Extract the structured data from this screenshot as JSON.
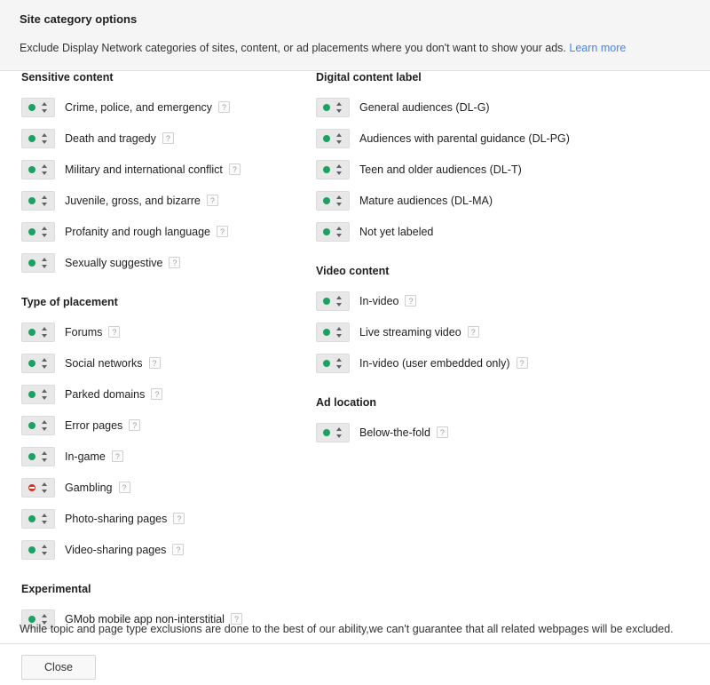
{
  "header": {
    "title": "Site category options",
    "description": "Exclude Display Network categories of sites, content, or ad placements where you don't want to show your ads.",
    "learn_more": "Learn more"
  },
  "status": {
    "included_label": "included",
    "excluded_label": "excluded"
  },
  "help_glyph": "?",
  "columns": {
    "left": [
      {
        "heading": "Sensitive content",
        "items": [
          {
            "label": "Crime, police, and emergency",
            "state": "included",
            "help": true
          },
          {
            "label": "Death and tragedy",
            "state": "included",
            "help": true
          },
          {
            "label": "Military and international conflict",
            "state": "included",
            "help": true
          },
          {
            "label": "Juvenile, gross, and bizarre",
            "state": "included",
            "help": true
          },
          {
            "label": "Profanity and rough language",
            "state": "included",
            "help": true
          },
          {
            "label": "Sexually suggestive",
            "state": "included",
            "help": true
          }
        ]
      },
      {
        "heading": "Type of placement",
        "items": [
          {
            "label": "Forums",
            "state": "included",
            "help": true
          },
          {
            "label": "Social networks",
            "state": "included",
            "help": true
          },
          {
            "label": "Parked domains",
            "state": "included",
            "help": true
          },
          {
            "label": "Error pages",
            "state": "included",
            "help": true
          },
          {
            "label": "In-game",
            "state": "included",
            "help": true
          },
          {
            "label": "Gambling",
            "state": "excluded",
            "help": true
          },
          {
            "label": "Photo-sharing pages",
            "state": "included",
            "help": true
          },
          {
            "label": "Video-sharing pages",
            "state": "included",
            "help": true
          }
        ]
      },
      {
        "heading": "Experimental",
        "items": [
          {
            "label": "GMob mobile app non-interstitial",
            "state": "included",
            "help": true
          }
        ]
      }
    ],
    "right": [
      {
        "heading": "Digital content label",
        "items": [
          {
            "label": "General audiences (DL-G)",
            "state": "included",
            "help": false
          },
          {
            "label": "Audiences with parental guidance (DL-PG)",
            "state": "included",
            "help": false
          },
          {
            "label": "Teen and older audiences (DL-T)",
            "state": "included",
            "help": false
          },
          {
            "label": "Mature audiences (DL-MA)",
            "state": "included",
            "help": false
          },
          {
            "label": "Not yet labeled",
            "state": "included",
            "help": false
          }
        ]
      },
      {
        "heading": "Video content",
        "items": [
          {
            "label": "In-video",
            "state": "included",
            "help": true
          },
          {
            "label": "Live streaming video",
            "state": "included",
            "help": true
          },
          {
            "label": "In-video (user embedded only)",
            "state": "included",
            "help": true
          }
        ]
      },
      {
        "heading": "Ad location",
        "items": [
          {
            "label": "Below-the-fold",
            "state": "included",
            "help": true
          }
        ]
      }
    ]
  },
  "disclaimer": "While topic and page type exclusions are done to the best of our ability,we can't guarantee that all related webpages will be excluded.",
  "footer": {
    "close_label": "Close"
  },
  "colors": {
    "included": "#1aa260",
    "excluded": "#d93025",
    "link": "#4285f4",
    "header_bg": "#f5f5f5",
    "border": "#e0e0e0"
  }
}
